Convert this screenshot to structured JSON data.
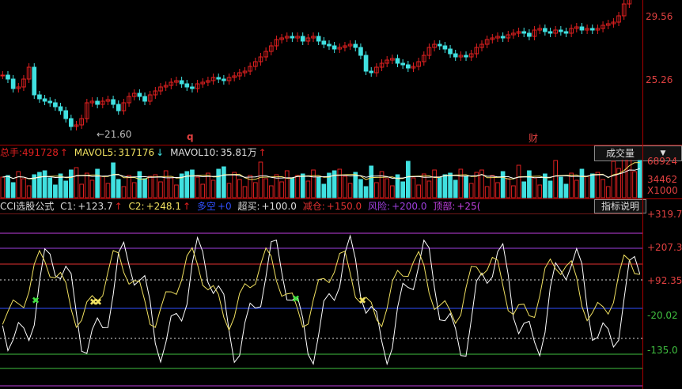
{
  "price_pane": {
    "right_axis": [
      "29.56",
      "25.26"
    ],
    "low_marker": "←21.60",
    "markers": [
      "q",
      "财"
    ]
  },
  "volume_pane": {
    "label_total": "总手:",
    "total_value": "491728",
    "total_arrow": "↑",
    "label_mavol5": "MAVOL5:",
    "mavol5_value": "317176",
    "mavol5_arrow": "↓",
    "label_mavol10": "MAVOL10:",
    "mavol10_value": "35.81万",
    "mavol10_arrow": "↑",
    "dropdown_label": "成交量",
    "dropdown_arrow": "▼",
    "right_axis": [
      "68924",
      "34462",
      "X1000"
    ]
  },
  "cci_pane": {
    "label_title": "CCI选股公式",
    "c1_label": "C1:",
    "c1_value": "+123.7",
    "c1_arrow": "↑",
    "c2_label": "C2:",
    "c2_value": "+248.1",
    "c2_arrow": "↑",
    "duokong_label": "多空",
    "duokong_value": "+0",
    "chaomai_label": "超买:",
    "chaomai_value": "+100.0",
    "jiancang_label": "减仓:",
    "jiancang_value": "+150.0",
    "fengxian_label": "风险:",
    "fengxian_value": "+200.0",
    "dingbu_label": "顶部:",
    "dingbu_value": "+25(",
    "help_button": "指标说明",
    "right_axis": [
      "+319.7",
      "+207.3",
      "+92.35",
      "-20.02",
      "-135.0"
    ]
  },
  "colors": {
    "up": "#e02020",
    "down": "#40e0e0",
    "background": "#000000"
  }
}
